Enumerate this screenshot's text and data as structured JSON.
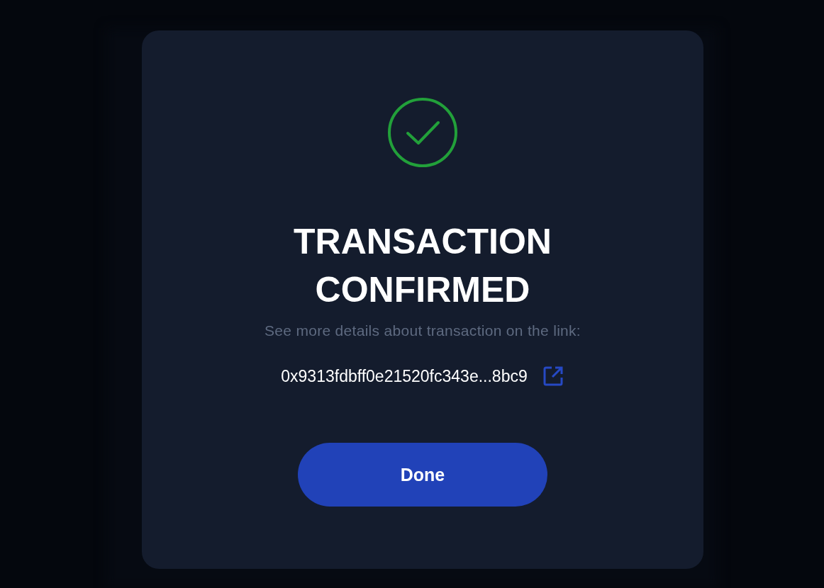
{
  "dialog": {
    "success": true,
    "title": "TRANSACTION CONFIRMED",
    "message": "See more details about transaction on the link:",
    "transaction_link": "0x9313fdbff0e21520fc343e...8bc9",
    "button": "Done"
  }
}
